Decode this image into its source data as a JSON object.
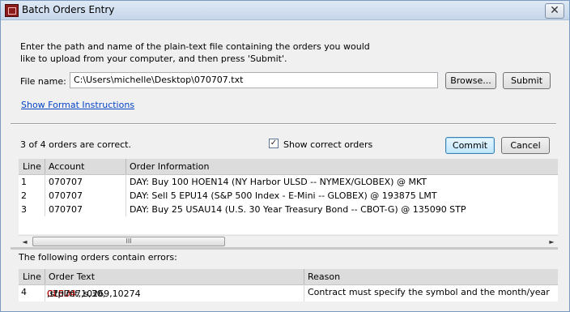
{
  "window": {
    "title": "Batch Orders Entry",
    "close_glyph": "✕"
  },
  "instructions": "Enter the path and name of the plain-text file containing the orders you would like to upload from your computer, and then press 'Submit'.",
  "file": {
    "label": "File name:",
    "value": "C:\\Users\\michelle\\Desktop\\070707.txt",
    "browse_label": "Browse...",
    "submit_label": "Submit"
  },
  "format_link": "Show Format Instructions",
  "status": {
    "correct_count_text": "3 of 4 orders are correct.",
    "show_correct_label": "Show correct orders",
    "show_correct_checked": true,
    "check_glyph": "✓"
  },
  "actions": {
    "commit_label": "Commit",
    "cancel_label": "Cancel"
  },
  "correct_orders": {
    "columns": [
      "Line",
      "Account",
      "Order Information"
    ],
    "rows": [
      {
        "line": "1",
        "account": "070707",
        "info": "DAY: Buy 100 HOEN14 (NY Harbor ULSD -- NYMEX/GLOBEX) @ MKT"
      },
      {
        "line": "2",
        "account": "070707",
        "info": "DAY: Sell 5 EPU14 (S&P 500 Index - E-Mini -- GLOBEX) @ 193875 LMT"
      },
      {
        "line": "3",
        "account": "070707",
        "info": "DAY: Buy 25 USAU14 (U.S. 30 Year Treasury Bond -- CBOT-G) @ 135090 STP"
      }
    ]
  },
  "scrollbar": {
    "left_arrow": "◄",
    "right_arrow": "►",
    "grip": "III"
  },
  "errors": {
    "label": "The following orders contain errors:",
    "columns": [
      "Line",
      "Order Text",
      "Reason"
    ],
    "rows": [
      {
        "line": "4",
        "text_before": "070707,s,30,",
        "text_error": "CLEU4",
        "text_after": ",stplmt,10269,10274",
        "reason": "Contract must specify the symbol and the month/year"
      }
    ]
  },
  "colors": {
    "error_text": "#d00000",
    "link": "#0645c8"
  },
  "icons": {
    "app": "app-icon",
    "close": "close-icon",
    "check": "check-icon",
    "scroll_left": "arrow-left-icon",
    "scroll_right": "arrow-right-icon"
  }
}
